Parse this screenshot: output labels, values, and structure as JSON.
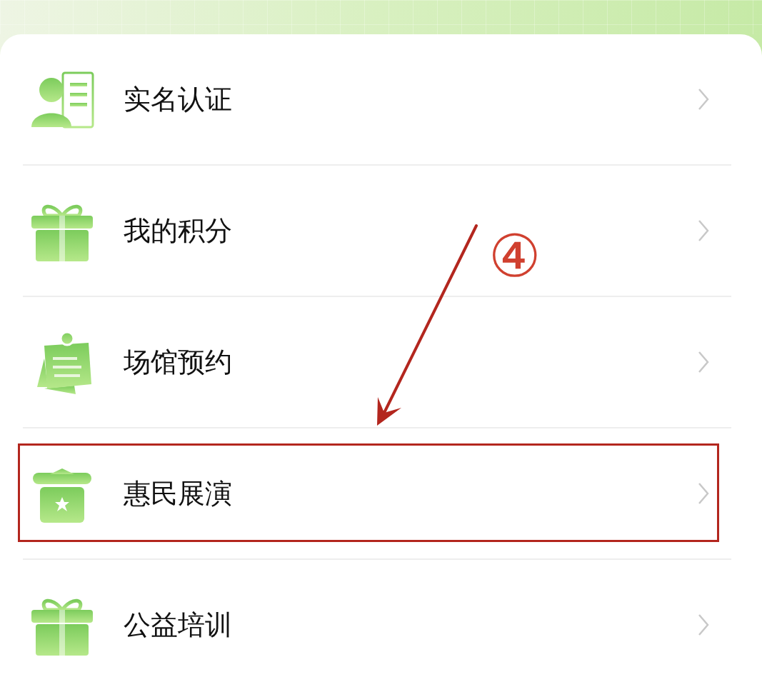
{
  "menu_items": [
    {
      "kind": "id-card",
      "label": "实名认证",
      "highlighted": false
    },
    {
      "kind": "gift",
      "label": "我的积分",
      "highlighted": false
    },
    {
      "kind": "note",
      "label": "场馆预约",
      "highlighted": false
    },
    {
      "kind": "star-box",
      "label": "惠民展演",
      "highlighted": true
    },
    {
      "kind": "gift",
      "label": "公益培训",
      "highlighted": false
    }
  ],
  "annotation": {
    "step_label": "④"
  }
}
